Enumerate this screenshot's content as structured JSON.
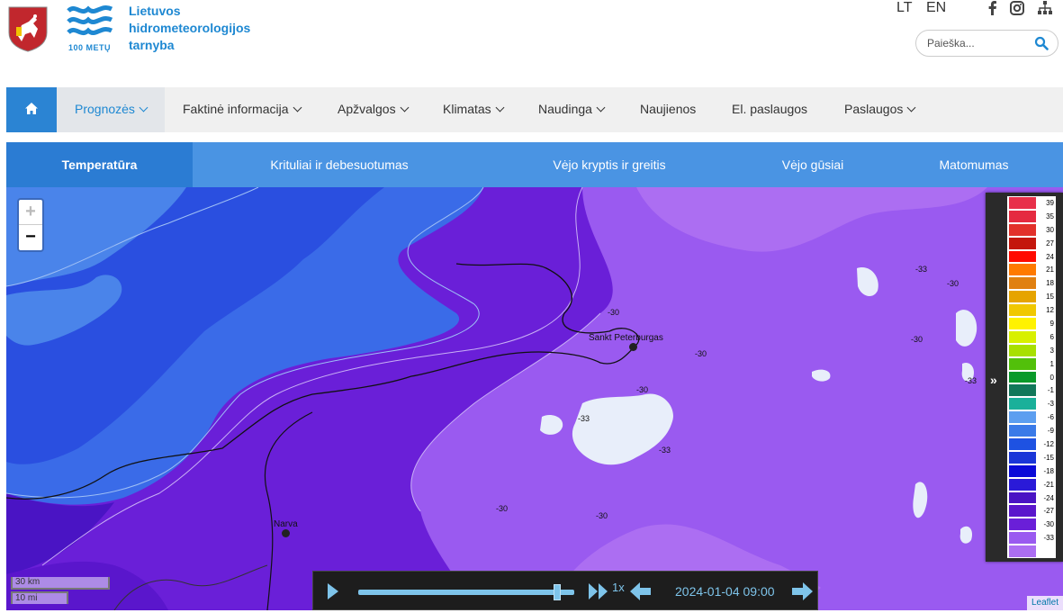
{
  "header": {
    "org_name_line1": "Lietuvos",
    "org_name_line2": "hidrometeorologijos",
    "org_name_line3": "tarnyba",
    "logo_subtitle": "100 METŲ",
    "languages": [
      "LT",
      "EN"
    ],
    "social_icons": [
      "facebook-icon",
      "instagram-icon",
      "sitemap-icon"
    ],
    "search_placeholder": "Paieška..."
  },
  "main_nav": {
    "home_icon": "home-icon",
    "items": [
      {
        "label": "Prognozės",
        "dropdown": true,
        "active": true
      },
      {
        "label": "Faktinė informacija",
        "dropdown": true
      },
      {
        "label": "Apžvalgos",
        "dropdown": true
      },
      {
        "label": "Klimatas",
        "dropdown": true
      },
      {
        "label": "Naudinga",
        "dropdown": true
      },
      {
        "label": "Naujienos",
        "dropdown": false
      },
      {
        "label": "El. paslaugos",
        "dropdown": false
      },
      {
        "label": "Paslaugos",
        "dropdown": true
      }
    ]
  },
  "sub_nav": {
    "items": [
      {
        "label": "Temperatūra",
        "active": true
      },
      {
        "label": "Krituliai ir debesuotumas"
      },
      {
        "label": "Vėjo kryptis ir greitis"
      },
      {
        "label": "Vėjo gūsiai"
      },
      {
        "label": "Matomumas"
      }
    ]
  },
  "map": {
    "zoom_in": "+",
    "zoom_out": "−",
    "cities": [
      "Sankt Peterburgas",
      "Narva"
    ],
    "contour_labels": [
      "-30",
      "-33"
    ],
    "scale_km": "30 km",
    "scale_mi": "10 mi",
    "attribution": "Leaflet"
  },
  "legend": {
    "toggle_icon": "double-chevron-right-icon",
    "entries": [
      {
        "value": "39",
        "color": "#e8304a"
      },
      {
        "value": "35",
        "color": "#e52a40"
      },
      {
        "value": "30",
        "color": "#e2302a"
      },
      {
        "value": "27",
        "color": "#c4160c"
      },
      {
        "value": "24",
        "color": "#ff0a00"
      },
      {
        "value": "21",
        "color": "#ff7a00"
      },
      {
        "value": "18",
        "color": "#e08010"
      },
      {
        "value": "15",
        "color": "#e6a400"
      },
      {
        "value": "12",
        "color": "#f0c800"
      },
      {
        "value": "9",
        "color": "#fff200"
      },
      {
        "value": "6",
        "color": "#d8f000"
      },
      {
        "value": "3",
        "color": "#a8e000"
      },
      {
        "value": "1",
        "color": "#52c00a"
      },
      {
        "value": "0",
        "color": "#0a9a2a"
      },
      {
        "value": "-1",
        "color": "#12785a"
      },
      {
        "value": "-3",
        "color": "#1ab09a"
      },
      {
        "value": "-6",
        "color": "#5c9ef0"
      },
      {
        "value": "-9",
        "color": "#3a7ae8"
      },
      {
        "value": "-12",
        "color": "#1e52e2"
      },
      {
        "value": "-15",
        "color": "#1a36d8"
      },
      {
        "value": "-18",
        "color": "#0a0ad8"
      },
      {
        "value": "-21",
        "color": "#2a1ad8"
      },
      {
        "value": "-24",
        "color": "#4a14c4"
      },
      {
        "value": "-27",
        "color": "#5a16cc"
      },
      {
        "value": "-30",
        "color": "#6a1fd8"
      },
      {
        "value": "-33",
        "color": "#9a5af0"
      },
      {
        "value": "",
        "color": "#ac6ef2"
      }
    ]
  },
  "player": {
    "play_icon": "play-icon",
    "fast_forward_icon": "fast-forward-icon",
    "speed": "1x",
    "prev_icon": "arrow-left-icon",
    "timestamp": "2024-01-04 09:00",
    "next_icon": "arrow-right-icon",
    "progress": 0.92
  },
  "colors": {
    "brand_blue": "#1e88d2",
    "nav_active_bg": "#2b84d3",
    "subnav_bg": "#4a94e3",
    "player_accent": "#7ec4ea"
  }
}
